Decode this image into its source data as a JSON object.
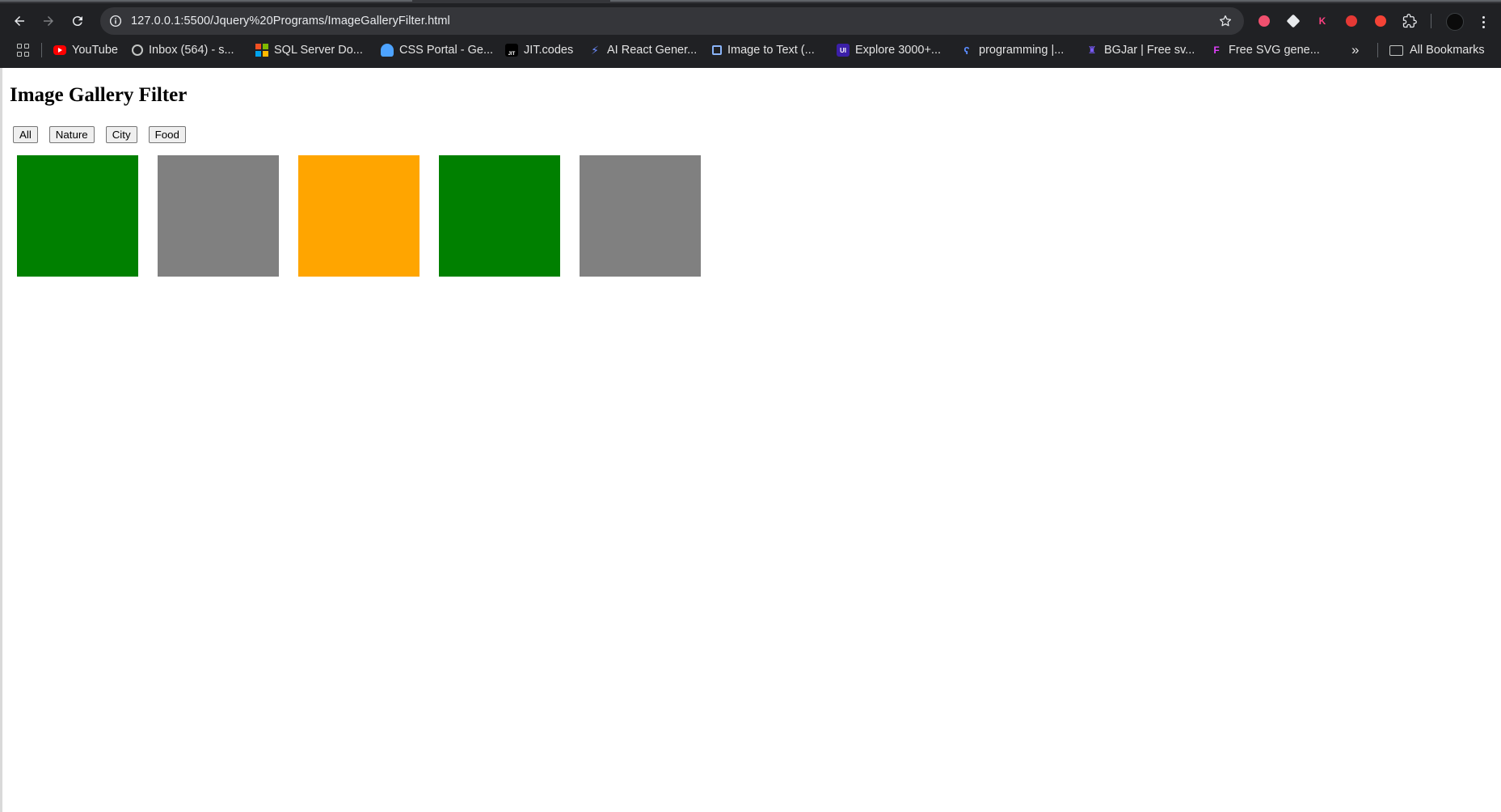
{
  "browser": {
    "url": "127.0.0.1:5500/Jquery%20Programs/ImageGalleryFilter.html",
    "bookmarks": [
      {
        "label": "YouTube",
        "icon": "youtube-icon",
        "color": "#ff0000"
      },
      {
        "label": "Inbox (564) - s...",
        "icon": "globe-icon",
        "color": "#c4c7c5"
      },
      {
        "label": "SQL Server Do...",
        "icon": "microsoft-icon",
        "color": "#f25022"
      },
      {
        "label": "CSS Portal - Ge...",
        "icon": "css-portal-icon",
        "color": "#4da3ff"
      },
      {
        "label": "JIT.codes",
        "icon": "jit-icon",
        "color": "#000000"
      },
      {
        "label": "AI React Gener...",
        "icon": "bolt-icon",
        "color": "#6c8cff"
      },
      {
        "label": "Image to Text (...",
        "icon": "image-to-text-icon",
        "color": "#8ab4f8"
      },
      {
        "label": "Explore 3000+...",
        "icon": "ui-icon",
        "color": "#3b1fa8"
      },
      {
        "label": "programming |...",
        "icon": "programming-icon",
        "color": "#5b8cff"
      },
      {
        "label": "BGJar | Free sv...",
        "icon": "bgjar-icon",
        "color": "#7b5cff"
      },
      {
        "label": "Free SVG gene...",
        "icon": "svg-generator-icon",
        "color": "#e040fb"
      }
    ],
    "all_bookmarks": "All Bookmarks"
  },
  "page": {
    "title": "Image Gallery Filter",
    "filters": [
      "All",
      "Nature",
      "City",
      "Food"
    ],
    "tiles": [
      {
        "category": "nature",
        "color": "#008000"
      },
      {
        "category": "city",
        "color": "#808080"
      },
      {
        "category": "food",
        "color": "#ffa500"
      },
      {
        "category": "nature",
        "color": "#008000"
      },
      {
        "category": "city",
        "color": "#808080"
      }
    ]
  }
}
